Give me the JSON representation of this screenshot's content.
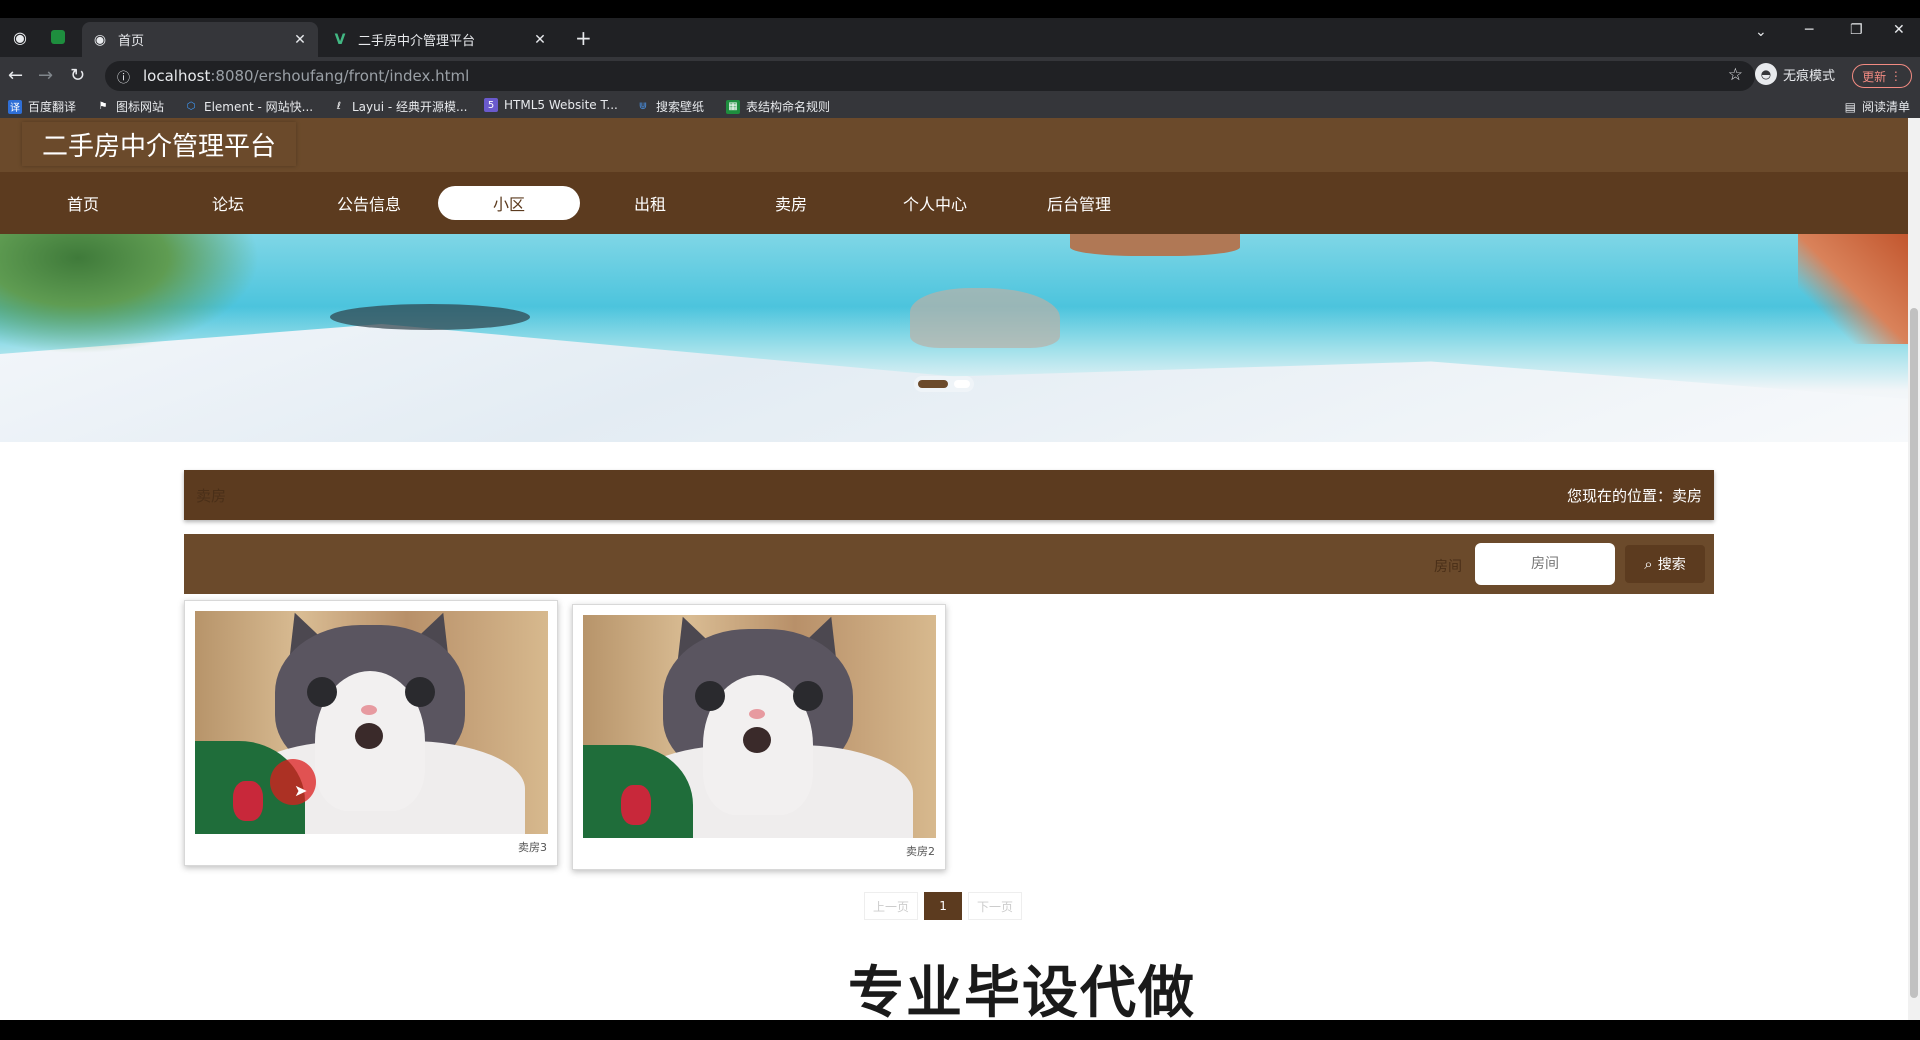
{
  "browser": {
    "tabs": [
      {
        "title": "首页",
        "active": true
      },
      {
        "title": "二手房中介管理平台",
        "active": false
      }
    ],
    "new_tab": "+",
    "url_host": "localhost",
    "url_rest": ":8080/ershoufang/front/index.html",
    "profile_label": "无痕模式",
    "update_label": "更新",
    "bookmarks": [
      "百度翻译",
      "图标网站",
      "Element - 网站快...",
      "Layui - 经典开源模...",
      "HTML5 Website T...",
      "搜索壁纸",
      "表结构命名规则"
    ],
    "reading_list": "阅读清单"
  },
  "site": {
    "logo": "二手房中介管理平台",
    "nav": [
      "首页",
      "论坛",
      "公告信息",
      "小区",
      "出租",
      "卖房",
      "个人中心",
      "后台管理"
    ],
    "nav_active_index": 3
  },
  "page": {
    "section_title": "卖房",
    "location": "您现在的位置：卖房",
    "search_label": "房间",
    "search_placeholder": "房间",
    "search_button": "搜索",
    "cards": [
      {
        "caption": "卖房3"
      },
      {
        "caption": "卖房2"
      }
    ],
    "pager": {
      "prev": "上一页",
      "current": "1",
      "next": "下一页"
    },
    "watermark": "专业毕设代做"
  },
  "colors": {
    "brand_dark": "#5c3b1f",
    "brand": "#6b4a2b"
  }
}
